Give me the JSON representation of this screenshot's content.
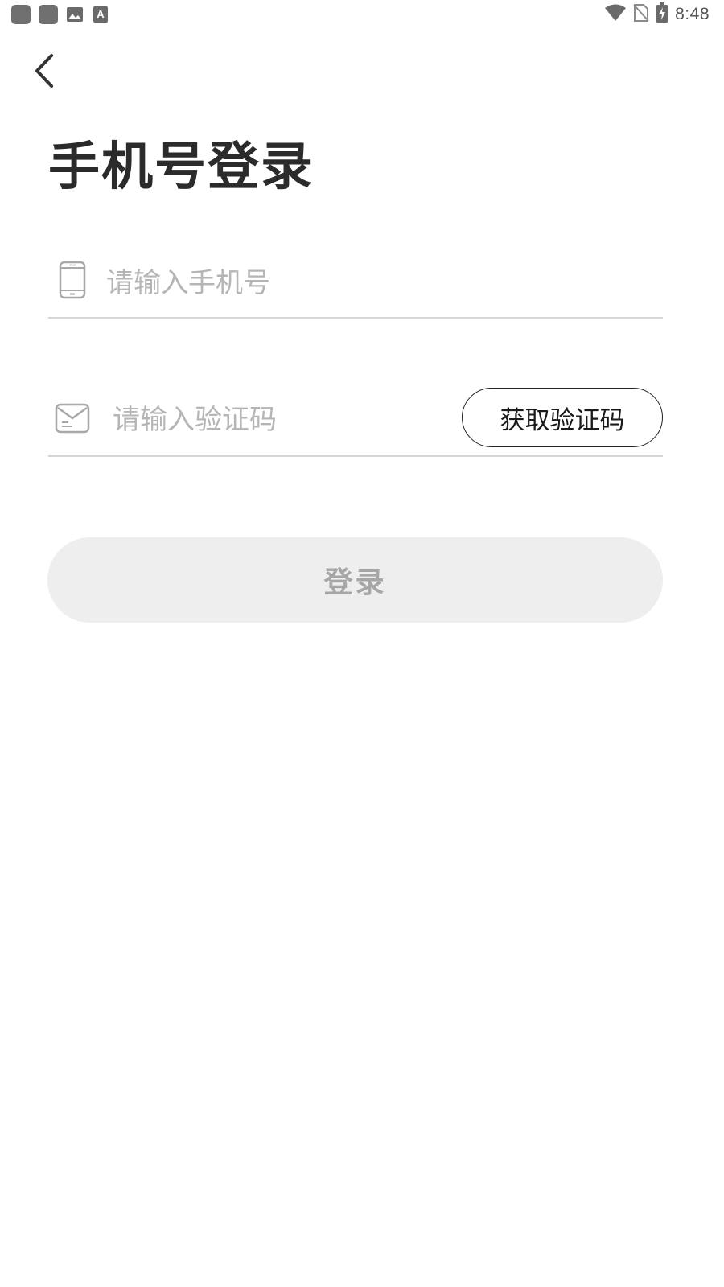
{
  "status_bar": {
    "time": "8:48",
    "left_icons": [
      "app-notification-icon",
      "app-notification-icon",
      "image-icon",
      "text-icon"
    ],
    "right_icons": [
      "wifi-icon",
      "no-sim-icon",
      "battery-charging-icon"
    ]
  },
  "header": {
    "back_icon": "chevron-left-icon"
  },
  "page": {
    "title": "手机号登录"
  },
  "form": {
    "phone": {
      "icon": "phone-icon",
      "value": "",
      "placeholder": "请输入手机号"
    },
    "code": {
      "icon": "envelope-icon",
      "value": "",
      "placeholder": "请输入验证码",
      "get_code_label": "获取验证码"
    },
    "login_label": "登录"
  },
  "colors": {
    "title": "#2b2b2b",
    "placeholder": "#b5b5b5",
    "divider": "#d6d6d6",
    "login_bg": "#eeeeee",
    "login_text": "#a6a6a6"
  }
}
